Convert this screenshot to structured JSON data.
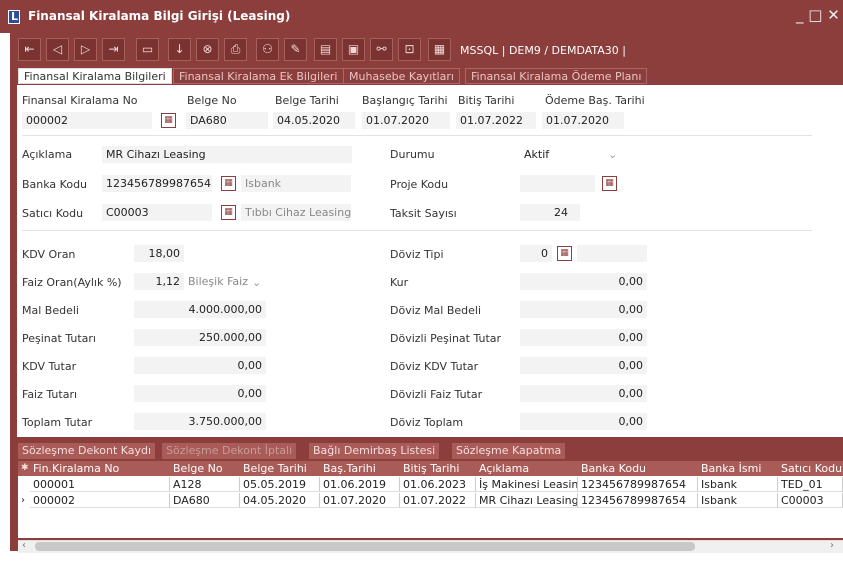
{
  "window": {
    "title": "Finansal Kiralama Bilgi Girişi (Leasing)",
    "controls": "_ □ ✕"
  },
  "toolbar": {
    "icons": [
      "first-icon",
      "prev-icon",
      "next-icon",
      "last-icon",
      "folder-icon",
      "download-icon",
      "cancel-icon",
      "print-icon",
      "user-icon",
      "edit-icon",
      "log-icon",
      "page-icon",
      "link-icon",
      "lock-icon",
      "xls-icon"
    ],
    "db_info": "MSSQL | DEM9 / DEMDATA30 |"
  },
  "tabs": [
    "Finansal Kiralama Bilgileri",
    "Finansal Kiralama Ek Bilgileri",
    "Muhasebe Kayıtları",
    "Finansal Kiralama Ödeme Planı"
  ],
  "header": {
    "labels": {
      "no": "Finansal Kiralama No",
      "belge_no": "Belge No",
      "belge_tarihi": "Belge Tarihi",
      "baslangic": "Başlangıç Tarihi",
      "bitis": "Bitiş Tarihi",
      "odeme_bas": "Ödeme Baş. Tarihi"
    },
    "values": {
      "no": "000002",
      "belge_no": "DA680",
      "belge_tarihi": "04.05.2020",
      "baslangic": "01.07.2020",
      "bitis": "01.07.2022",
      "odeme_bas": "01.07.2020"
    }
  },
  "form": {
    "aciklama_label": "Açıklama",
    "aciklama": "MR Cihazı Leasing",
    "banka_label": "Banka Kodu",
    "banka_kodu": "123456789987654",
    "banka_adi": "Isbank",
    "satici_label": "Satıcı Kodu",
    "satici_kodu": "C00003",
    "satici_adi": "Tıbbı Cihaz Leasing",
    "durum_label": "Durumu",
    "durum": "Aktif",
    "proje_label": "Proje Kodu",
    "proje": "",
    "taksit_label": "Taksit Sayısı",
    "taksit": "24"
  },
  "amounts_left": {
    "kdv_oran_label": "KDV Oran",
    "kdv_oran": "18,00",
    "faiz_oran_label": "Faiz Oran(Aylık %)",
    "faiz_oran": "1,12",
    "faiz_tipi": "Bileşik Faiz",
    "mal_bedeli_label": "Mal Bedeli",
    "mal_bedeli": "4.000.000,00",
    "pesinat_label": "Peşinat Tutarı",
    "pesinat": "250.000,00",
    "kdv_tutar_label": "KDV Tutar",
    "kdv_tutar": "0,00",
    "faiz_tutar_label": "Faiz Tutarı",
    "faiz_tutar": "0,00",
    "toplam_label": "Toplam Tutar",
    "toplam": "3.750.000,00"
  },
  "amounts_right": {
    "doviz_tipi_label": "Döviz Tipi",
    "doviz_tipi": "0",
    "kur_label": "Kur",
    "kur": "0,00",
    "doviz_mal_label": "Döviz Mal Bedeli",
    "doviz_mal": "0,00",
    "doviz_pesinat_label": "Dövizli Peşinat Tutar",
    "doviz_pesinat": "0,00",
    "doviz_kdv_label": "Döviz KDV Tutar",
    "doviz_kdv": "0,00",
    "doviz_faiz_label": "Dövizli Faiz Tutar",
    "doviz_faiz": "0,00",
    "doviz_toplam_label": "Döviz Toplam",
    "doviz_toplam": "0,00"
  },
  "bottom_tabs": [
    "Sözleşme Dekont Kaydı",
    "Sözleşme Dekont İptali",
    "Bağlı Demirbaş Listesi",
    "Sözleşme Kapatma"
  ],
  "grid": {
    "columns": [
      "Fin.Kiralama No",
      "Belge No",
      "Belge Tarihi",
      "Baş.Tarihi",
      "Bitiş Tarihi",
      "Açıklama",
      "Banka Kodu",
      "Banka İsmi",
      "Satıcı Kodu"
    ],
    "rows": [
      [
        "000001",
        "A128",
        "05.05.2019",
        "01.06.2019",
        "01.06.2023",
        "İş Makinesi Leasing",
        "123456789987654",
        "Isbank",
        "TED_01"
      ],
      [
        "000002",
        "DA680",
        "04.05.2020",
        "01.07.2020",
        "01.07.2022",
        "MR Cihazı Leasing",
        "123456789987654",
        "Isbank",
        "C00003"
      ]
    ]
  }
}
